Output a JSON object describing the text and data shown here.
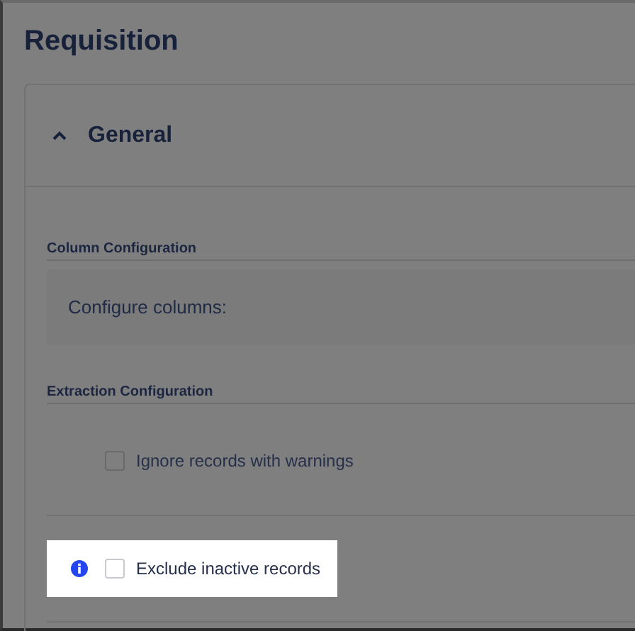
{
  "page": {
    "title": "Requisition"
  },
  "panel": {
    "title": "General",
    "expanded": true
  },
  "column_configuration": {
    "heading": "Column Configuration",
    "text": "Configure columns:"
  },
  "extraction_configuration": {
    "heading": "Extraction Configuration",
    "options": [
      {
        "label": "Ignore records with warnings",
        "checked": false,
        "highlighted": false,
        "info": false
      },
      {
        "label": "Exclude inactive records",
        "checked": false,
        "highlighted": true,
        "info": true
      }
    ]
  }
}
